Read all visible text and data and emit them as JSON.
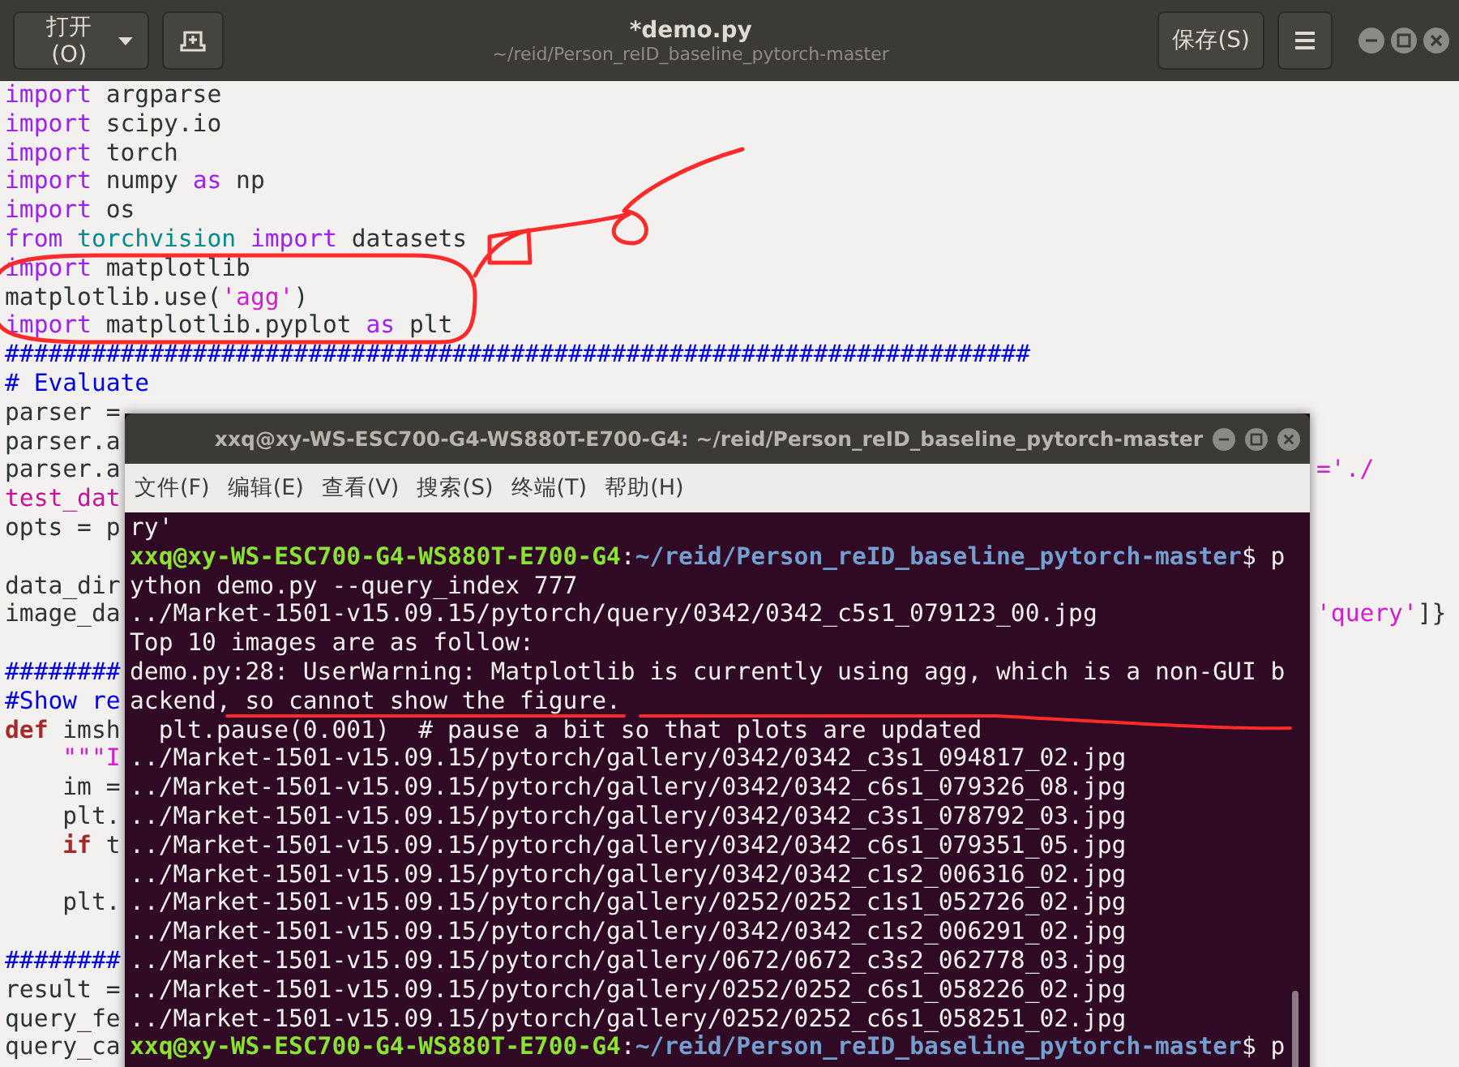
{
  "header": {
    "open_button": "打开(O)",
    "title": "*demo.py",
    "subtitle": "~/reid/Person_reID_baseline_pytorch-master",
    "save_button": "保存(S)"
  },
  "editor": {
    "lines": [
      {
        "kind": "code",
        "tokens": [
          {
            "text": "import",
            "kind": "kw"
          },
          {
            "text": " argparse",
            "kind": "plain"
          }
        ]
      },
      {
        "kind": "code",
        "tokens": [
          {
            "text": "import",
            "kind": "kw"
          },
          {
            "text": " scipy.io",
            "kind": "plain"
          }
        ]
      },
      {
        "kind": "code",
        "tokens": [
          {
            "text": "import",
            "kind": "kw"
          },
          {
            "text": " torch",
            "kind": "plain"
          }
        ]
      },
      {
        "kind": "code",
        "tokens": [
          {
            "text": "import",
            "kind": "kw"
          },
          {
            "text": " numpy ",
            "kind": "plain"
          },
          {
            "text": "as",
            "kind": "kw"
          },
          {
            "text": " np",
            "kind": "plain"
          }
        ]
      },
      {
        "kind": "code",
        "tokens": [
          {
            "text": "import",
            "kind": "kw"
          },
          {
            "text": " os",
            "kind": "plain"
          }
        ]
      },
      {
        "kind": "code",
        "tokens": [
          {
            "text": "from",
            "kind": "kw"
          },
          {
            "text": " torchvision ",
            "kind": "mod"
          },
          {
            "text": "import",
            "kind": "kw"
          },
          {
            "text": " datasets",
            "kind": "plain"
          }
        ]
      },
      {
        "kind": "code",
        "tokens": [
          {
            "text": "import",
            "kind": "kw"
          },
          {
            "text": " matplotlib",
            "kind": "plain"
          }
        ]
      },
      {
        "kind": "code",
        "tokens": [
          {
            "text": "matplotlib.use(",
            "kind": "plain"
          },
          {
            "text": "'agg'",
            "kind": "str"
          },
          {
            "text": ")",
            "kind": "plain"
          }
        ]
      },
      {
        "kind": "code",
        "tokens": [
          {
            "text": "import",
            "kind": "kw"
          },
          {
            "text": " matplotlib.pyplot ",
            "kind": "plain"
          },
          {
            "text": "as",
            "kind": "kw"
          },
          {
            "text": " plt",
            "kind": "plain"
          }
        ]
      },
      {
        "kind": "code",
        "tokens": [
          {
            "text": "#######################################################################",
            "kind": "comment"
          }
        ]
      },
      {
        "kind": "code",
        "tokens": [
          {
            "text": "# Evaluate",
            "kind": "comment"
          }
        ]
      },
      {
        "kind": "code",
        "tokens": [
          {
            "text": "parser =",
            "kind": "plain"
          }
        ]
      },
      {
        "kind": "code",
        "tokens": [
          {
            "text": "parser.a",
            "kind": "plain"
          }
        ]
      },
      {
        "kind": "code",
        "tokens": [
          {
            "text": "parser.a",
            "kind": "plain"
          }
        ],
        "right": [
          {
            "text": "='./",
            "kind": "str"
          }
        ]
      },
      {
        "kind": "code",
        "tokens": [
          {
            "text": "test_dat",
            "kind": "special"
          }
        ]
      },
      {
        "kind": "code",
        "tokens": [
          {
            "text": "opts = p",
            "kind": "plain"
          }
        ]
      },
      {
        "kind": "blank"
      },
      {
        "kind": "code",
        "tokens": [
          {
            "text": "data_dir",
            "kind": "plain"
          }
        ]
      },
      {
        "kind": "code",
        "tokens": [
          {
            "text": "image_da",
            "kind": "plain"
          }
        ],
        "right": [
          {
            "text": "'query'",
            "kind": "str"
          },
          {
            "text": "]}",
            "kind": "plain"
          }
        ]
      },
      {
        "kind": "blank"
      },
      {
        "kind": "code",
        "tokens": [
          {
            "text": "########",
            "kind": "comment"
          }
        ]
      },
      {
        "kind": "code",
        "tokens": [
          {
            "text": "#Show re",
            "kind": "comment"
          }
        ]
      },
      {
        "kind": "code",
        "tokens": [
          {
            "text": "def",
            "kind": "def"
          },
          {
            "text": " imsh",
            "kind": "plain"
          }
        ]
      },
      {
        "kind": "code",
        "tokens": [
          {
            "text": "    \"\"\"I",
            "kind": "str"
          }
        ]
      },
      {
        "kind": "code",
        "tokens": [
          {
            "text": "    im =",
            "kind": "plain"
          }
        ]
      },
      {
        "kind": "code",
        "tokens": [
          {
            "text": "    plt.",
            "kind": "plain"
          }
        ]
      },
      {
        "kind": "code",
        "tokens": [
          {
            "text": "    if",
            "kind": "def"
          },
          {
            "text": " t",
            "kind": "plain"
          }
        ]
      },
      {
        "kind": "blank"
      },
      {
        "kind": "code",
        "tokens": [
          {
            "text": "    plt.",
            "kind": "plain"
          }
        ]
      },
      {
        "kind": "blank"
      },
      {
        "kind": "code",
        "tokens": [
          {
            "text": "########",
            "kind": "comment"
          }
        ]
      },
      {
        "kind": "code",
        "tokens": [
          {
            "text": "result =",
            "kind": "plain"
          }
        ]
      },
      {
        "kind": "code",
        "tokens": [
          {
            "text": "query_fe",
            "kind": "plain"
          }
        ]
      },
      {
        "kind": "code",
        "tokens": [
          {
            "text": "query_ca",
            "kind": "plain"
          }
        ]
      }
    ]
  },
  "terminal": {
    "title": "xxq@xy-WS-ESC700-G4-WS880T-E700-G4: ~/reid/Person_reID_baseline_pytorch-master",
    "menu": [
      "文件(F)",
      "编辑(E)",
      "查看(V)",
      "搜索(S)",
      "终端(T)",
      "帮助(H)"
    ],
    "lines": [
      [
        {
          "text": "ry'",
          "kind": "plain"
        }
      ],
      [
        {
          "text": "xxq@xy-WS-ESC700-G4-WS880T-E700-G4",
          "kind": "user"
        },
        {
          "text": ":",
          "kind": "plain"
        },
        {
          "text": "~/reid/Person_reID_baseline_pytorch-master",
          "kind": "path"
        },
        {
          "text": "$ p",
          "kind": "plain"
        }
      ],
      [
        {
          "text": "ython demo.py --query_index 777",
          "kind": "plain"
        }
      ],
      [
        {
          "text": "../Market-1501-v15.09.15/pytorch/query/0342/0342_c5s1_079123_00.jpg",
          "kind": "plain"
        }
      ],
      [
        {
          "text": "Top 10 images are as follow:",
          "kind": "plain"
        }
      ],
      [
        {
          "text": "demo.py:28: UserWarning: Matplotlib is currently using agg, which is a non-GUI b",
          "kind": "plain"
        }
      ],
      [
        {
          "text": "ackend, so cannot show the figure.",
          "kind": "plain"
        }
      ],
      [
        {
          "text": "  plt.pause(0.001)  # pause a bit so that plots are updated",
          "kind": "plain"
        }
      ],
      [
        {
          "text": "../Market-1501-v15.09.15/pytorch/gallery/0342/0342_c3s1_094817_02.jpg",
          "kind": "plain"
        }
      ],
      [
        {
          "text": "../Market-1501-v15.09.15/pytorch/gallery/0342/0342_c6s1_079326_08.jpg",
          "kind": "plain"
        }
      ],
      [
        {
          "text": "../Market-1501-v15.09.15/pytorch/gallery/0342/0342_c3s1_078792_03.jpg",
          "kind": "plain"
        }
      ],
      [
        {
          "text": "../Market-1501-v15.09.15/pytorch/gallery/0342/0342_c6s1_079351_05.jpg",
          "kind": "plain"
        }
      ],
      [
        {
          "text": "../Market-1501-v15.09.15/pytorch/gallery/0342/0342_c1s2_006316_02.jpg",
          "kind": "plain"
        }
      ],
      [
        {
          "text": "../Market-1501-v15.09.15/pytorch/gallery/0252/0252_c1s1_052726_02.jpg",
          "kind": "plain"
        }
      ],
      [
        {
          "text": "../Market-1501-v15.09.15/pytorch/gallery/0342/0342_c1s2_006291_02.jpg",
          "kind": "plain"
        }
      ],
      [
        {
          "text": "../Market-1501-v15.09.15/pytorch/gallery/0672/0672_c3s2_062778_03.jpg",
          "kind": "plain"
        }
      ],
      [
        {
          "text": "../Market-1501-v15.09.15/pytorch/gallery/0252/0252_c6s1_058226_02.jpg",
          "kind": "plain"
        }
      ],
      [
        {
          "text": "../Market-1501-v15.09.15/pytorch/gallery/0252/0252_c6s1_058251_02.jpg",
          "kind": "plain"
        }
      ],
      [
        {
          "text": "xxq@xy-WS-ESC700-G4-WS880T-E700-G4",
          "kind": "user"
        },
        {
          "text": ":",
          "kind": "plain"
        },
        {
          "text": "~/reid/Person_reID_baseline_pytorch-master",
          "kind": "path"
        },
        {
          "text": "$ p",
          "kind": "plain"
        }
      ]
    ]
  }
}
